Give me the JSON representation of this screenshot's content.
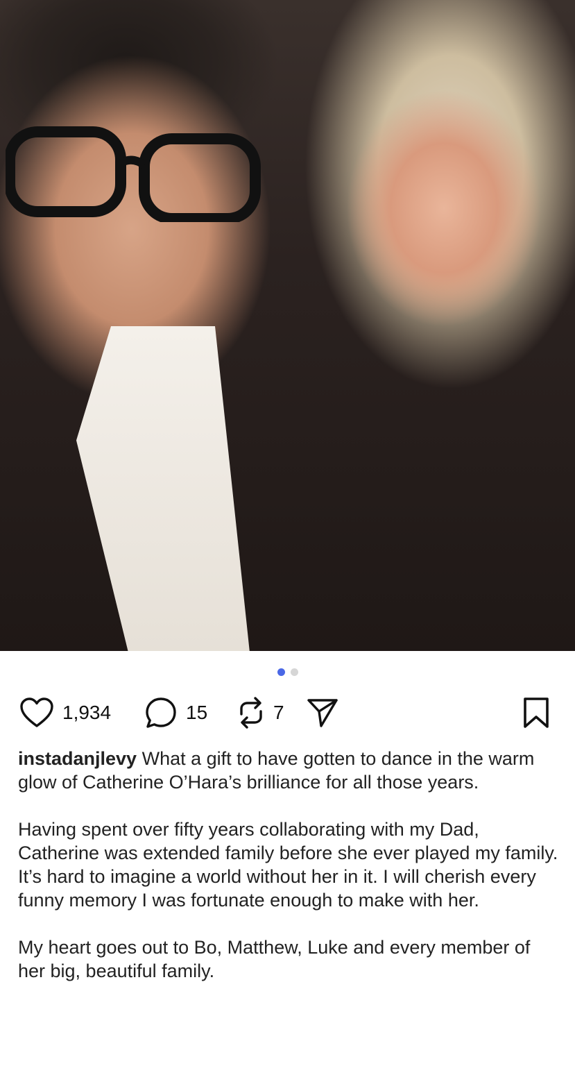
{
  "post": {
    "image_alt": "Selfie of a man with glasses and a woman with blonde hair",
    "carousel": {
      "current": 1,
      "total": 2
    },
    "username": "instadanjlevy",
    "caption_first": " What a gift to have gotten to dance in the warm glow of Catherine O’Hara’s brilliance for all those years.",
    "caption_second": "Having spent over fifty years collaborating with my Dad, Catherine was extended family before she ever played my family. It’s hard to imagine a world without her in it. I will cherish every funny memory I was fortunate enough to make with her.",
    "caption_third": "My heart goes out to Bo, Matthew, Luke and every member of her big, beautiful family."
  },
  "actions": {
    "likes": "1,934",
    "comments": "15",
    "reposts": "7"
  },
  "icons": {
    "like": "heart-icon",
    "comment": "comment-bubble-icon",
    "repost": "repost-arrows-icon",
    "share": "send-paper-plane-icon",
    "save": "bookmark-icon"
  },
  "colors": {
    "carousel_active": "#4a68e6",
    "carousel_inactive": "#d6d6d6"
  }
}
